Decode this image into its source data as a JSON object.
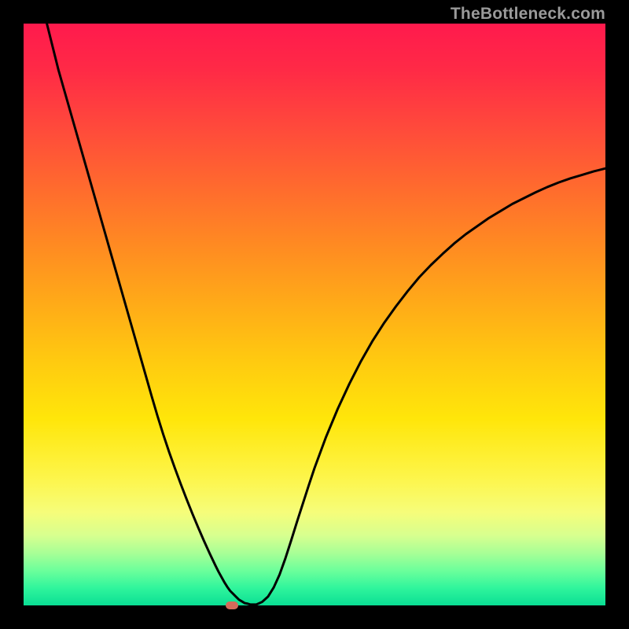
{
  "watermark": "TheBottleneck.com",
  "colors": {
    "frame": "#000000",
    "watermark": "#9a9a9a",
    "curve": "#000000",
    "marker": "#d46a5a",
    "gradient_top": "#ff1a4d",
    "gradient_bottom": "#0adf94"
  },
  "chart_data": {
    "type": "line",
    "title": "",
    "xlabel": "",
    "ylabel": "",
    "xlim": [
      0,
      100
    ],
    "ylim": [
      0,
      100
    ],
    "grid": false,
    "legend": false,
    "marker": {
      "x": 35.8,
      "y": 0
    },
    "series": [
      {
        "name": "bottleneck-curve",
        "x": [
          0,
          1,
          2,
          3,
          4,
          5,
          6,
          7,
          8,
          9,
          10,
          11,
          12,
          13,
          14,
          15,
          16,
          17,
          18,
          19,
          20,
          21,
          22,
          23,
          24,
          25,
          26,
          27,
          28,
          29,
          30,
          31,
          32,
          33,
          33.5,
          34,
          34.5,
          35,
          35.5,
          36,
          36.5,
          37,
          37.5,
          38,
          38.5,
          39,
          40,
          41,
          42,
          43,
          44,
          45,
          46,
          47,
          48,
          49,
          50,
          52,
          54,
          56,
          58,
          60,
          62,
          64,
          66,
          68,
          70,
          72,
          74,
          76,
          78,
          80,
          82,
          84,
          86,
          88,
          90,
          92,
          94,
          96,
          98,
          100
        ],
        "values": [
          118,
          112.5,
          108,
          104,
          100,
          96,
          92,
          88.5,
          85,
          81.5,
          78,
          74.5,
          71,
          67.5,
          64,
          60.5,
          57,
          53.5,
          50,
          46.5,
          43,
          39.5,
          36,
          32.6,
          29.4,
          26.4,
          23.6,
          20.9,
          18.3,
          15.8,
          13.4,
          11.1,
          8.9,
          6.8,
          5.8,
          4.9,
          4.0,
          3.2,
          2.5,
          2.0,
          1.5,
          1.0,
          0.7,
          0.4,
          0.3,
          0.15,
          0.15,
          0.6,
          1.5,
          3.1,
          5.3,
          8.1,
          11.2,
          14.4,
          17.5,
          20.6,
          23.6,
          29.0,
          33.8,
          38.1,
          42.0,
          45.5,
          48.6,
          51.4,
          54.0,
          56.4,
          58.5,
          60.4,
          62.2,
          63.8,
          65.2,
          66.6,
          67.8,
          69.0,
          70.0,
          71.0,
          71.9,
          72.7,
          73.4,
          74.0,
          74.6,
          75.1
        ]
      }
    ]
  }
}
